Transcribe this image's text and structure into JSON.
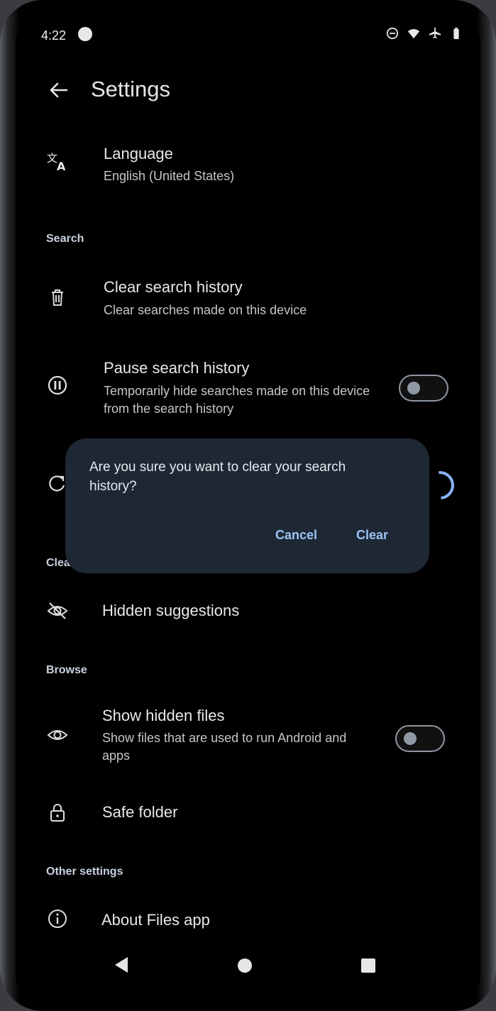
{
  "status_bar": {
    "time": "4:22",
    "icons": [
      "app-notification-icon",
      "do-not-disturb-icon",
      "wifi-icon",
      "airplane-icon",
      "battery-icon"
    ]
  },
  "header": {
    "title": "Settings",
    "back_icon": "back-arrow-icon"
  },
  "language": {
    "icon": "translate-icon",
    "title": "Language",
    "value": "English (United States)"
  },
  "search_section": {
    "header": "Search",
    "clear_history": {
      "icon": "trash-icon",
      "title": "Clear search history",
      "subtitle": "Clear searches made on this device"
    },
    "pause_history": {
      "icon": "pause-icon",
      "title": "Pause search history",
      "subtitle": "Temporarily hide searches made on this device from the search history",
      "enabled": false
    },
    "partial_row_icon": "refresh-icon",
    "partial_header": "Clea"
  },
  "dialog": {
    "message": "Are you sure you want to clear your search history?",
    "cancel_label": "Cancel",
    "confirm_label": "Clear"
  },
  "hidden_suggestions": {
    "icon": "eye-off-icon",
    "title": "Hidden suggestions"
  },
  "browse_section": {
    "header": "Browse",
    "show_hidden": {
      "icon": "eye-icon",
      "title": "Show hidden files",
      "subtitle": "Show files that are used to run Android and apps",
      "enabled": false
    },
    "safe_folder": {
      "icon": "lock-icon",
      "title": "Safe folder"
    }
  },
  "other_section": {
    "header": "Other settings",
    "about": {
      "icon": "info-icon",
      "title": "About Files app"
    }
  },
  "colors": {
    "background": "#000000",
    "dialog": "#1e2834",
    "accent": "#9cc3f5",
    "toggle_off": "#8f98a3"
  },
  "nav_bar": {
    "back": "nav-back-icon",
    "home": "nav-home-icon",
    "recents": "nav-recents-icon"
  }
}
